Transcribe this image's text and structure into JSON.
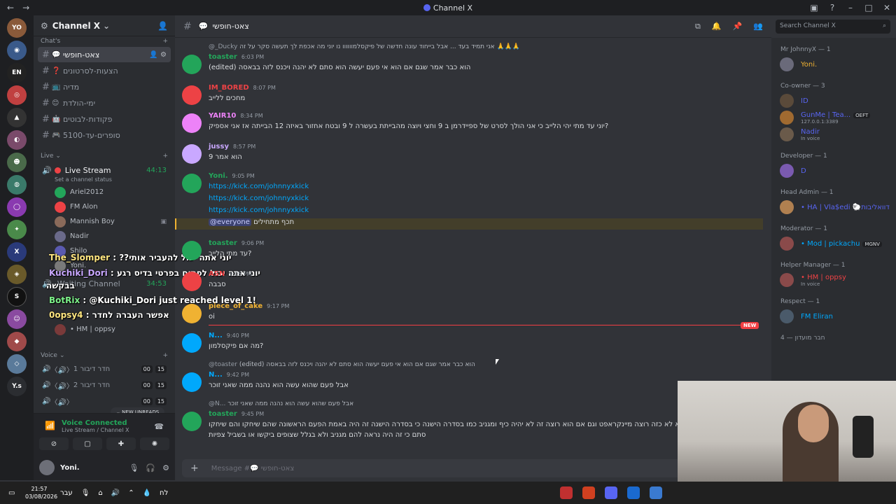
{
  "titlebar": {
    "title": "Channel X"
  },
  "server": {
    "name": "Channel X"
  },
  "channels": {
    "category_chats": "Chat's",
    "items": [
      {
        "emoji": "💬",
        "name": "צאט-חופשי",
        "active": true
      },
      {
        "emoji": "❓",
        "name": "הצעות-לסרטונים"
      },
      {
        "emoji": "📺",
        "name": "מדיה"
      },
      {
        "emoji": "😊",
        "name": "ימי-הולדת"
      },
      {
        "emoji": "🤖",
        "name": "פקודות-לבוטים"
      },
      {
        "emoji": "🎮",
        "name": "סופרים-עד-5100"
      }
    ],
    "category_live": "Live",
    "live_stream": {
      "name": "Live Stream",
      "time": "44:13",
      "status": "Set a channel status"
    },
    "voice_users": [
      "Ariel2012",
      "FM Alon",
      "Mannish Boy",
      "Nadir",
      "Shilo",
      "Yoni."
    ],
    "waiting": {
      "name": "Waiting Channel",
      "time": "34:53"
    },
    "waiting_user": "• HM | oppsy",
    "category_voice": "Voice",
    "voice_channels": [
      {
        "name": "חדר דיבור 1",
        "a": "00",
        "b": "15"
      },
      {
        "name": "חדר דיבור 2",
        "a": "00",
        "b": "15"
      },
      {
        "name": "",
        "a": "00",
        "b": "15"
      }
    ],
    "new_unreads": "NEW UNREADS"
  },
  "overlay": [
    {
      "name": "The_Slomper",
      "text": ": ??יוני אתה יכול להעביר אותי"
    },
    {
      "name": "Kuchiki_Dori",
      "text": ": יוני אתה יכול לפתוח בפרטי בדיס רגע"
    },
    {
      "name": "",
      "text": "בבקשה"
    },
    {
      "name": "BotRix",
      "text": ": @Kuchiki_Dori just reached level 1!"
    },
    {
      "name": "0opsy4",
      "text": ": אפשר העברה לחדר"
    }
  ],
  "voice_panel": {
    "title": "Voice Connected",
    "sub": "Live Stream / Channel X"
  },
  "user": {
    "name": "Yoni.",
    "status": ""
  },
  "chat": {
    "channel": "צאט-חופשי",
    "placeholder": "Message #💬 צאט-חופשי"
  },
  "search": {
    "placeholder": "Search Channel X"
  },
  "messages": [
    {
      "reply_author": "@_Ducky",
      "reply": "אני תמיד בעד ... אבל בייחוד עונה חדשה של פיקסלמוווווו נו יוני מה אכפת לך תעשה סקר על זה 🙏🙏🙏",
      "author": "toaster",
      "color": "#23a55a",
      "time": "6:03 PM",
      "text": "(edited) הוא כבר אמר שגם אם הוא אי פעם יעשה הוא סתם לא יהנה ויכנס לזה בבאסה"
    },
    {
      "author": "IM_BORED",
      "color": "#ed4245",
      "time": "8:07 PM",
      "text": "מחכים ללייב"
    },
    {
      "author": "YAIR10",
      "color": "#ed82f8",
      "time": "8:34 PM",
      "text": "יוני עד מתי יהי הלייב כי אני הולך לסרט של ספיידרמן ב 9 וחצי ויוצה מהבייתת בעשרה ל 9 ובטח אחזור באיזה 12 הבייתה אז אני אספיק?"
    },
    {
      "author": "jussy",
      "color": "#c9a8ff",
      "time": "8:57 PM",
      "text": "הוא אמר 9"
    },
    {
      "author": "Yoni.",
      "color": "#23a55a",
      "time": "9:05 PM",
      "links": [
        "https://kick.com/johnnyxkick",
        "https://kick.com/johnnyxkick",
        "https://kick.com/johnnyxkick"
      ],
      "mention": "@everyone",
      "text": "תכף מתחילים"
    },
    {
      "author": "toaster",
      "color": "#23a55a",
      "time": "9:06 PM",
      "text": "עד מתי הלייב?"
    },
    {
      "author": "ASN",
      "color": "#ed4245",
      "time": "9:06 PM",
      "text": "סבבה"
    },
    {
      "author": "piece_of_cake",
      "color": "#f0b232",
      "time": "9:17 PM",
      "text": "oi"
    },
    {
      "author": "N...",
      "color": "#00a8fc",
      "time": "9:40 PM",
      "text": "מה אם פיקסלמון?"
    },
    {
      "reply_author": "@toaster",
      "reply": "(edited) הוא כבר אמר שגם אם הוא אי פעם יעשה הוא סתם לא יהנה ויכנס לזה בבאסה",
      "author": "N...",
      "color": "#00a8fc",
      "time": "9:42 PM",
      "text": "אבל פעם שהוא עשה הוא נהנה ממה שאני זוכר"
    },
    {
      "reply_author": "@N...",
      "reply": "אבל פעם שהוא עשה הוא נהנה ממה שאני זוכר",
      "author": "toaster",
      "color": "#23a55a",
      "time": "9:45 PM",
      "text": "לייב שהוא לא כזה רוצה מיינקראפט וגם אם הוא רוצה זה לא יהיה כיף ומגניב כמו בסדרה הישנה כי בסדרה הישנה זה היה באמת הפעם הראשונה שהם שיחקו והם שיחקו",
      "text2": "סתם כי זה היה נראה להם מגניב ולא בגלל שצופים ביקשו או בשביל צפיות"
    }
  ],
  "new_badge": "NEW",
  "members": {
    "roles": [
      {
        "title": "Mr JohnnyX — 1",
        "members": [
          {
            "name": "Yoni.",
            "color": "#f0b232",
            "sub": ""
          }
        ]
      },
      {
        "title": "Co-owner — 3",
        "members": [
          {
            "name": "ID",
            "color": "#5865f2",
            "sub": ""
          },
          {
            "name": "GunMe | Tea...",
            "color": "#5865f2",
            "sub": "127.0.0.1:3389",
            "tag": "OEFT"
          },
          {
            "name": "Nadir",
            "color": "#5865f2",
            "sub": "In voice"
          }
        ]
      },
      {
        "title": "Developer — 1",
        "members": [
          {
            "name": "D",
            "color": "#5865f2",
            "sub": ""
          }
        ]
      },
      {
        "title": "Head Admin — 1",
        "members": [
          {
            "name": "• HA | Vla$edi 🐑דוואליבות",
            "color": "#5865f2",
            "sub": ""
          }
        ]
      },
      {
        "title": "Moderator — 1",
        "members": [
          {
            "name": "• Mod | pickachu",
            "color": "#00a8fc",
            "sub": "",
            "tag": "MGNV"
          }
        ]
      },
      {
        "title": "Helper Manager — 1",
        "members": [
          {
            "name": "• HM | oppsy",
            "color": "#ed4245",
            "sub": "In voice"
          }
        ]
      },
      {
        "title": "Respect — 1",
        "members": [
          {
            "name": "FM Eliran",
            "color": "#00a8fc",
            "sub": ""
          }
        ]
      },
      {
        "title": "חבר מועדון — 4",
        "members": []
      }
    ]
  },
  "taskbar": {
    "time": "21:57",
    "date": "03/08/2026",
    "lang": "עבר",
    "weather": "לח"
  },
  "colors": {
    "accent": "#5865f2",
    "green": "#23a55a",
    "red": "#ed4245"
  }
}
